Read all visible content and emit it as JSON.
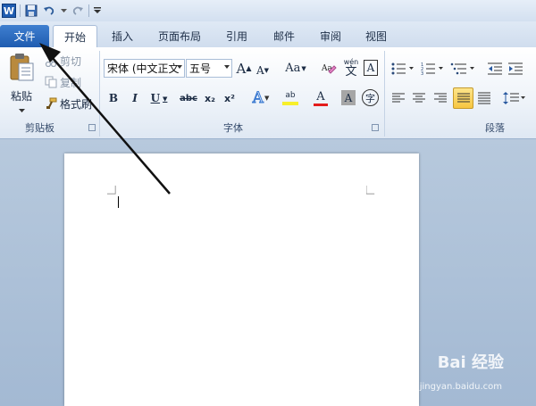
{
  "qat": {
    "app_icon": "W"
  },
  "tabs": [
    {
      "label": "文件"
    },
    {
      "label": "开始"
    },
    {
      "label": "插入"
    },
    {
      "label": "页面布局"
    },
    {
      "label": "引用"
    },
    {
      "label": "邮件"
    },
    {
      "label": "审阅"
    },
    {
      "label": "视图"
    }
  ],
  "clipboard": {
    "paste_label": "粘贴",
    "cut_label": "剪切",
    "copy_label": "复制",
    "format_painter_label": "格式刷",
    "group_label": "剪贴板"
  },
  "font": {
    "font_name": "宋体 (中文正文",
    "font_size": "五号",
    "grow_label": "A",
    "shrink_label": "A",
    "case_label": "Aa",
    "phonetic_label": "wén",
    "phonetic_char": "文",
    "border_char": "A",
    "bold": "B",
    "italic": "I",
    "underline": "U",
    "strike": "abc",
    "subscript": "x₂",
    "superscript": "x²",
    "effect": "A",
    "highlight": "ab",
    "font_color": "A",
    "shading": "A",
    "enclosed": "字",
    "group_label": "字体"
  },
  "paragraph": {
    "group_label": "段落"
  },
  "watermark": {
    "brand": "Bai  经验",
    "url": "jingyan.baidu.com"
  }
}
